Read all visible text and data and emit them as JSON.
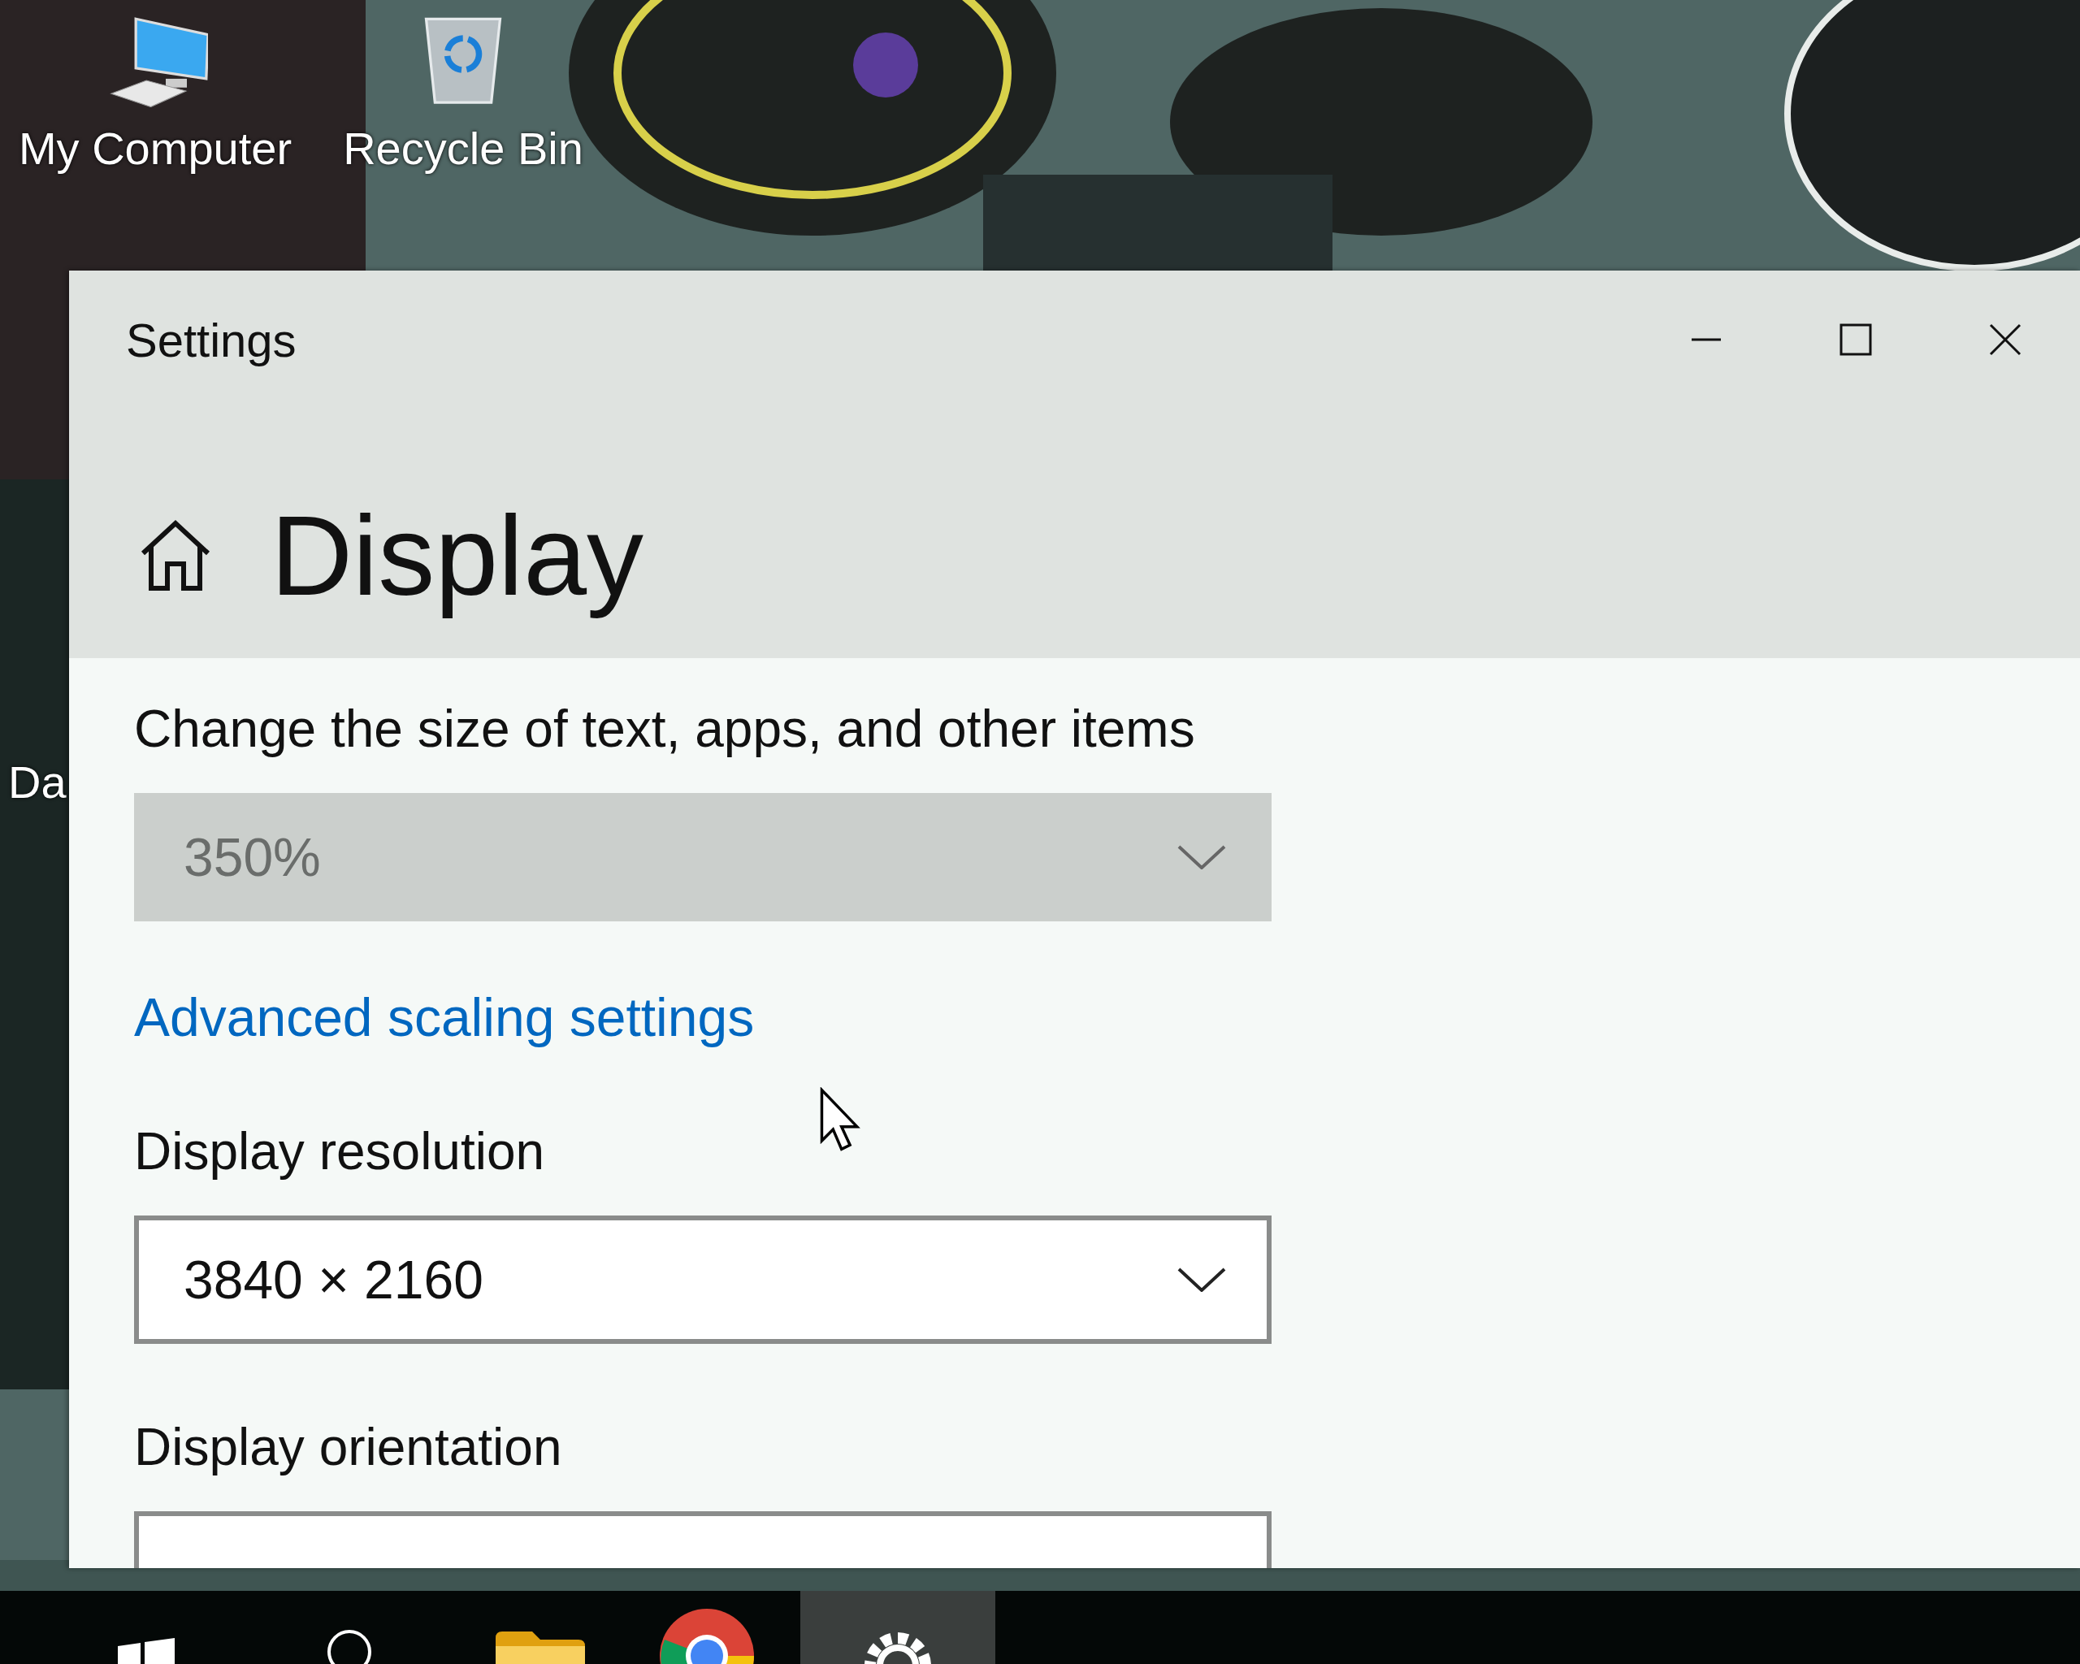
{
  "desktop": {
    "icons": [
      {
        "label": "My Computer",
        "kind": "computer"
      },
      {
        "label": "Recycle Bin",
        "kind": "bin"
      }
    ],
    "partial_labels": [
      "Da"
    ]
  },
  "window": {
    "title": "Settings",
    "page_title": "Display",
    "items": [
      {
        "kind": "heading",
        "text": "Change the size of text, apps, and other items"
      },
      {
        "kind": "dropdown",
        "value": "350%",
        "disabled": true
      },
      {
        "kind": "link",
        "text": "Advanced scaling settings"
      },
      {
        "kind": "heading",
        "text": "Display resolution"
      },
      {
        "kind": "dropdown",
        "value": "3840 × 2160",
        "disabled": false
      },
      {
        "kind": "heading",
        "text": "Display orientation"
      },
      {
        "kind": "dropdown",
        "disabled": false
      }
    ]
  },
  "taskbar": {
    "apps": [
      {
        "kind": "start",
        "selected": false
      },
      {
        "kind": "search",
        "selected": false
      },
      {
        "kind": "folder",
        "selected": false
      },
      {
        "kind": "browser",
        "selected": false
      },
      {
        "kind": "settings",
        "selected": true
      }
    ]
  }
}
